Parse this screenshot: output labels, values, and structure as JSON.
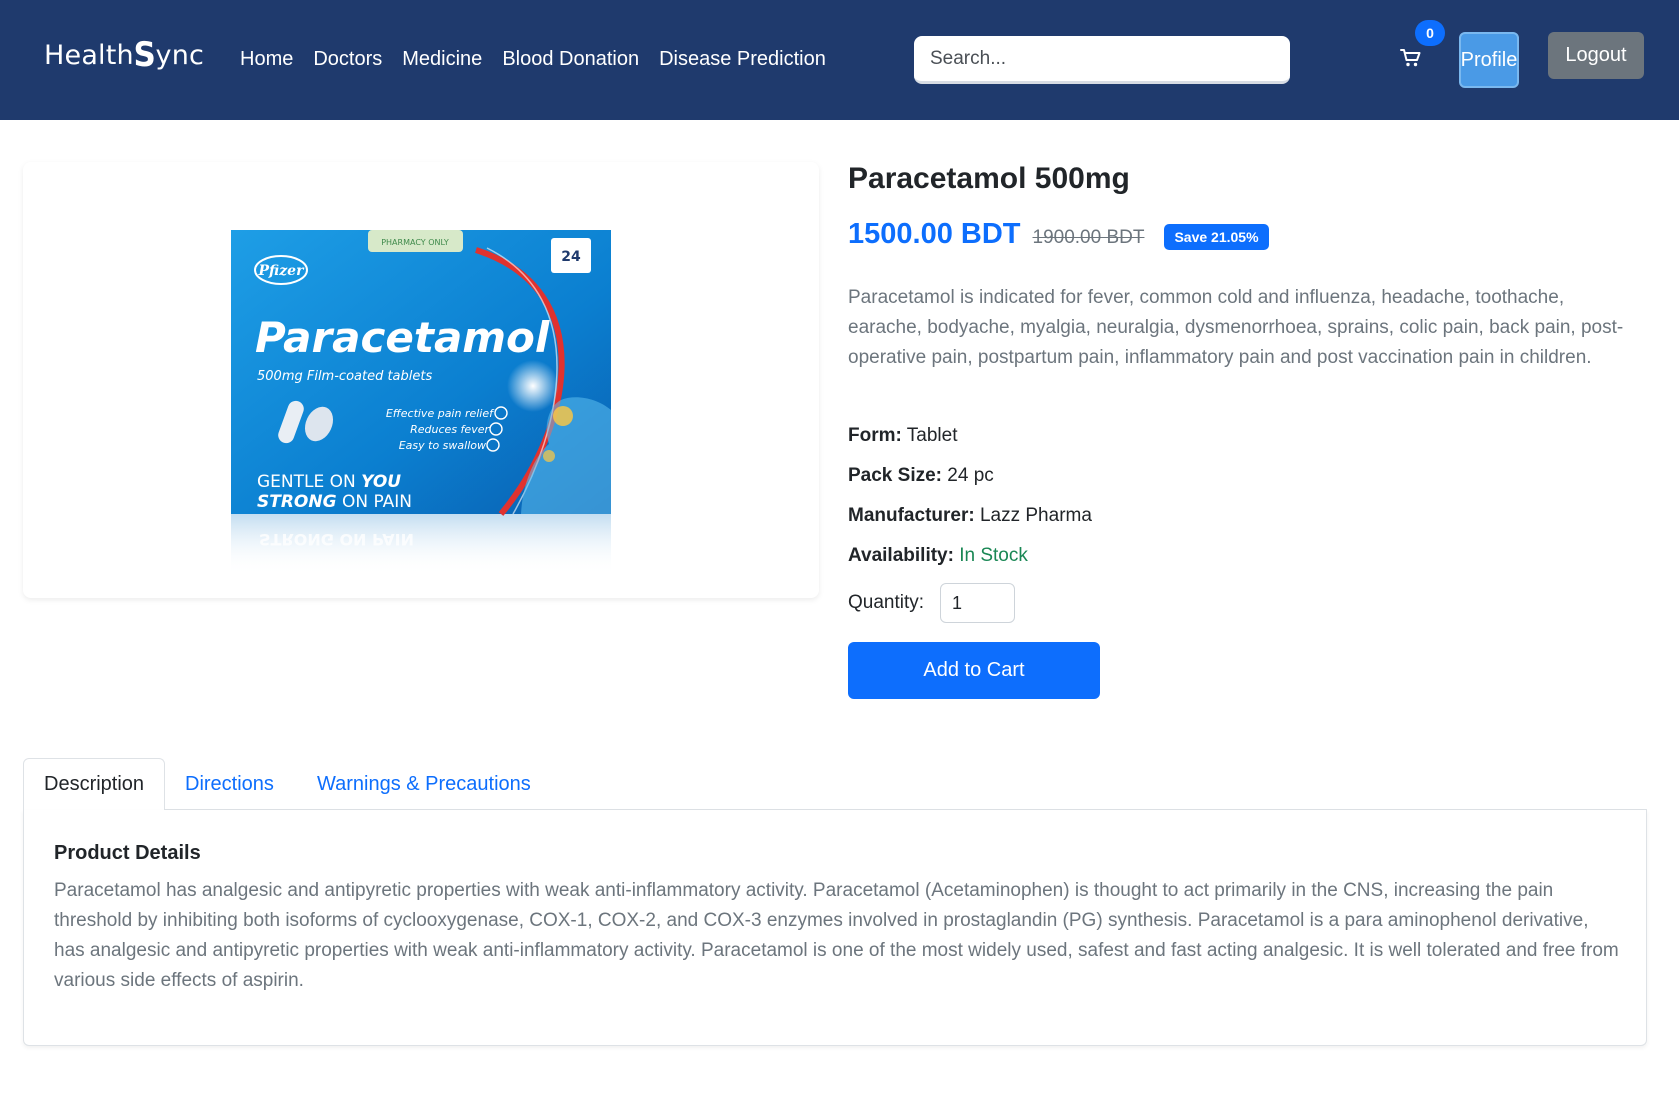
{
  "navbar": {
    "brand_prefix": "Health",
    "brand_s": "S",
    "brand_suffix": "ync",
    "links": [
      "Home",
      "Doctors",
      "Medicine",
      "Blood Donation",
      "Disease Prediction"
    ],
    "search_placeholder": "Search...",
    "cart_count": "0",
    "profile_label": "Profile",
    "logout_label": "Logout"
  },
  "product": {
    "title": "Paracetamol 500mg",
    "price": "1500.00 BDT",
    "old_price": "1900.00 BDT",
    "save_badge": "Save 21.05%",
    "short_description": "Paracetamol is indicated for fever, common cold and influenza, headache, toothache, earache, bodyache, myalgia, neuralgia, dysmenorrhoea, sprains, colic pain, back pain, post-operative pain, postpartum pain, inflammatory pain and post vaccination pain in children.",
    "specs": {
      "form_label": "Form:",
      "form_value": "Tablet",
      "pack_label": "Pack Size:",
      "pack_value": "24 pc",
      "manufacturer_label": "Manufacturer:",
      "manufacturer_value": "Lazz Pharma",
      "availability_label": "Availability:",
      "availability_value": "In Stock"
    },
    "quantity_label": "Quantity:",
    "quantity_value": "1",
    "add_to_cart_label": "Add to Cart",
    "image": {
      "pharmacy_only": "PHARMACY ONLY",
      "count": "24",
      "maker": "Pfizer",
      "name": "Paracetamol",
      "subtitle": "500mg Film-coated tablets",
      "benefit_1": "Effective pain relief",
      "benefit_2": "Reduces fever",
      "benefit_3": "Easy to swallow",
      "slogan_1a": "GENTLE ON",
      "slogan_1b": "YOU",
      "slogan_2a": "STRONG",
      "slogan_2b": "ON PAIN",
      "reflection": "STRONG ON PAIN"
    }
  },
  "tabs": {
    "items": [
      "Description",
      "Directions",
      "Warnings & Precautions"
    ],
    "active": "Description",
    "panel_title": "Product Details",
    "panel_text": "Paracetamol has analgesic and antipyretic properties with weak anti-inflammatory activity. Paracetamol (Acetaminophen) is thought to act primarily in the CNS, increasing the pain threshold by inhibiting both isoforms of cyclooxygenase, COX-1, COX-2, and COX-3 enzymes involved in prostaglandin (PG) synthesis. Paracetamol is a para aminophenol derivative, has analgesic and antipyretic properties with weak anti-inflammatory activity. Paracetamol is one of the most widely used, safest and fast acting analgesic. It is well tolerated and free from various side effects of aspirin."
  },
  "colors": {
    "navbar": "#1f3a6d",
    "primary": "#0d6efd",
    "in_stock": "#198754",
    "muted": "#6c757d"
  }
}
